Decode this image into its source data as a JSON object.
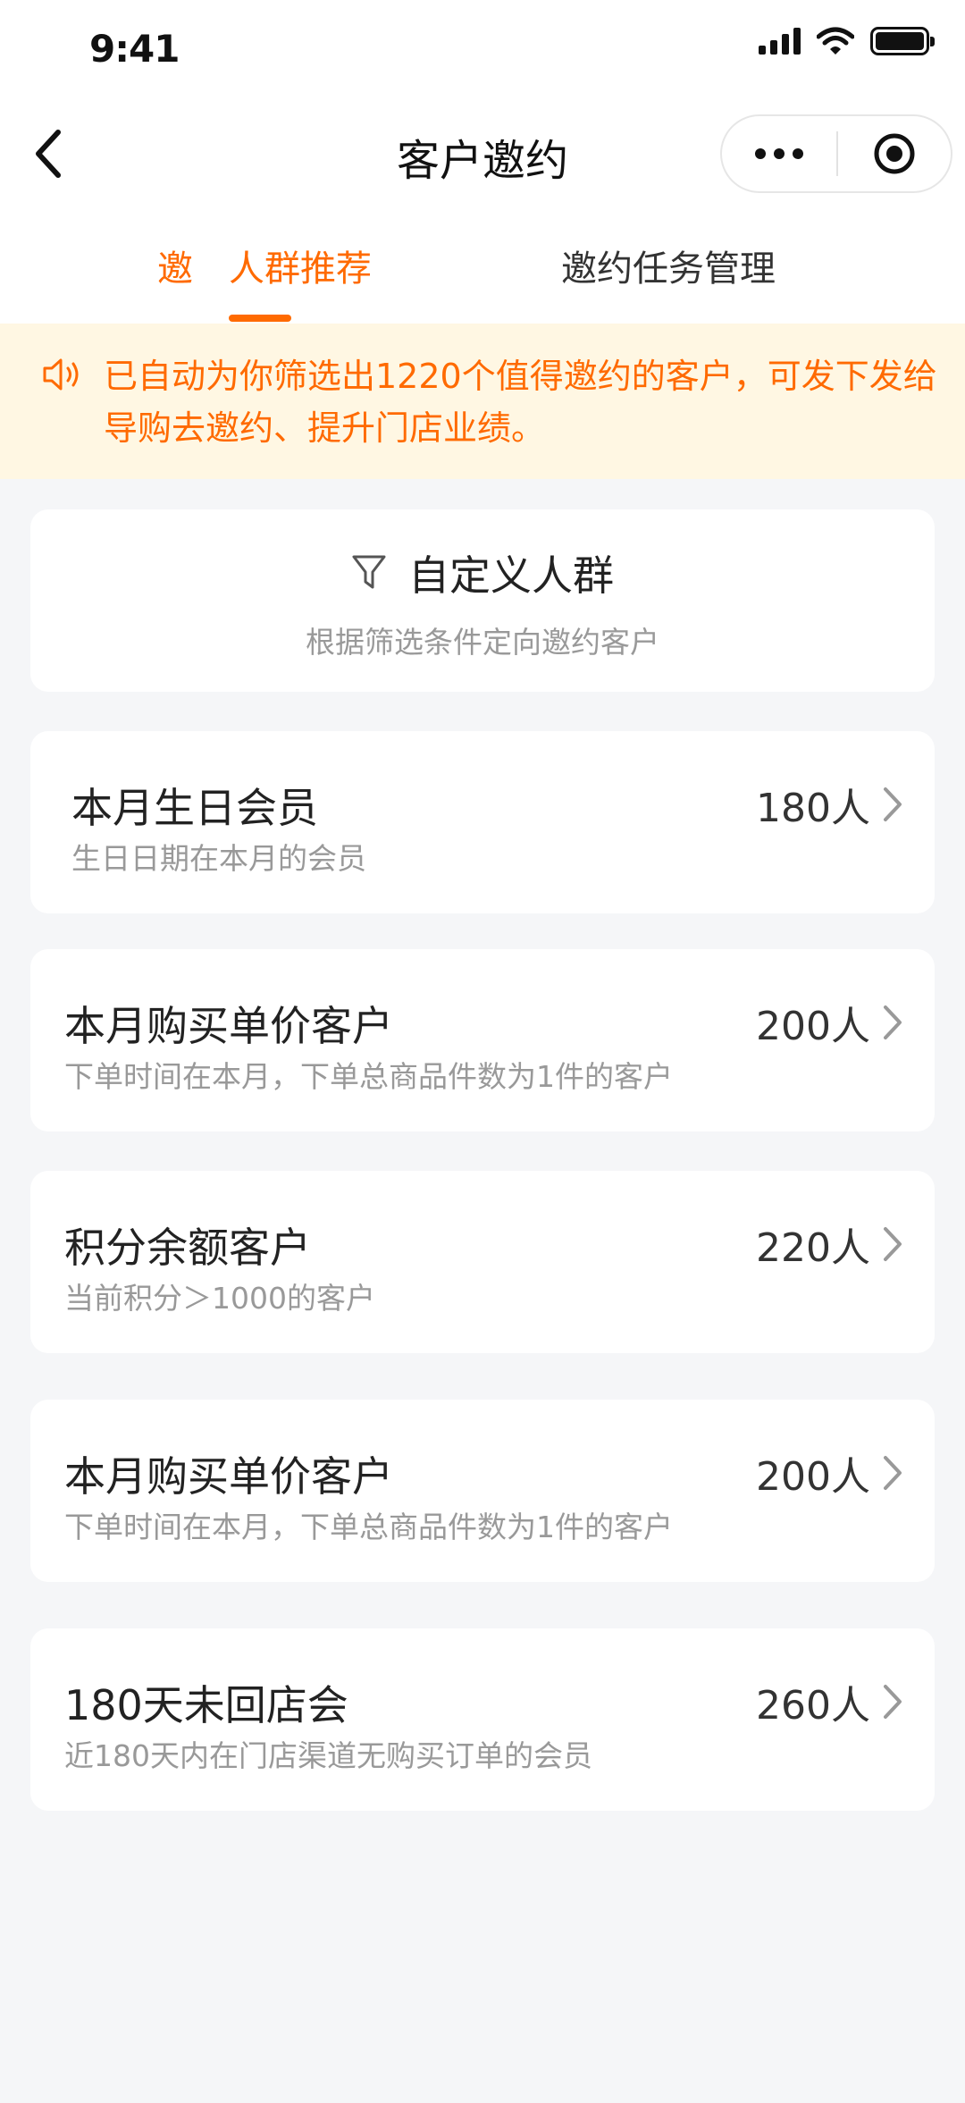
{
  "status_bar": {
    "time": "9:41"
  },
  "nav": {
    "title": "客户邀约"
  },
  "tabs": {
    "cut_label": "邀",
    "active_label": "人群推荐",
    "manage_label": "邀约任务管理"
  },
  "notice": {
    "text": "已自动为你筛选出1220个值得邀约的客户，可发下发给导购去邀约、提升门店业绩。"
  },
  "custom_group": {
    "title": "自定义人群",
    "subtitle": "根据筛选条件定向邀约客户"
  },
  "segments": [
    {
      "name": "本月生日会员",
      "desc": "生日日期在本月的会员",
      "count": "180人"
    },
    {
      "name": "本月购买单价客户",
      "desc": "下单时间在本月，下单总商品件数为1件的客户",
      "count": "200人"
    },
    {
      "name": "积分余额客户",
      "desc": "当前积分＞1000的客户",
      "count": "220人"
    },
    {
      "name": "本月购买单价客户",
      "desc": "下单时间在本月，下单总商品件数为1件的客户",
      "count": "200人"
    },
    {
      "name": "180天未回店会",
      "desc": "近180天内在门店渠道无购买订单的会员",
      "count": "260人"
    }
  ],
  "colors": {
    "accent": "#ff6a00",
    "notice_bg": "#fff7e3",
    "page_bg": "#f5f6f8"
  }
}
